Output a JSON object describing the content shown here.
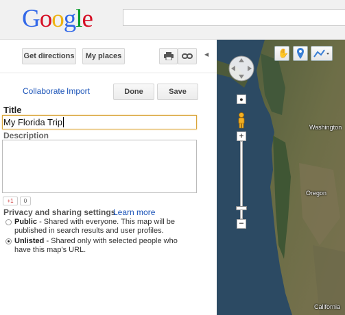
{
  "header": {
    "logo_letters": [
      {
        "ch": "G",
        "color": "#3369e8"
      },
      {
        "ch": "o",
        "color": "#d50f25"
      },
      {
        "ch": "o",
        "color": "#eeb211"
      },
      {
        "ch": "g",
        "color": "#3369e8"
      },
      {
        "ch": "l",
        "color": "#009925"
      },
      {
        "ch": "e",
        "color": "#d50f25"
      }
    ],
    "search": {
      "value": "",
      "placeholder": ""
    }
  },
  "toolbar": {
    "directions_label": "Get directions",
    "myplaces_label": "My places",
    "print_icon": "printer-icon",
    "link_icon": "link-icon",
    "collapse_icon": "collapse-arrow-icon"
  },
  "editor": {
    "collaborate_label": "Collaborate",
    "import_label": "Import",
    "done_label": "Done",
    "save_label": "Save",
    "title_label": "Title",
    "title_value": "My Florida Trip",
    "description_label": "Description",
    "description_value": "",
    "plusone_label": "+1",
    "plusone_count": "0"
  },
  "privacy": {
    "heading": "Privacy and sharing settings",
    "learn_more": "Learn more",
    "public": {
      "name": "Public",
      "line1": " - Shared with everyone. This map will be",
      "line2": "published in search results and user profiles.",
      "selected": false
    },
    "unlisted": {
      "name": "Unlisted",
      "line1": " - Shared only with selected people who",
      "line2": "have this map's URL.",
      "selected": true
    }
  },
  "map": {
    "labels": {
      "washington": "Washington",
      "oregon": "Oregon",
      "california": "California"
    },
    "controls": {
      "hand_icon": "hand-pan-icon",
      "marker_icon": "placemark-icon",
      "line_icon": "draw-line-icon"
    },
    "colors": {
      "ocean": "#2c4a63",
      "land": "#6a6f4a",
      "forest": "#3f5634"
    }
  }
}
